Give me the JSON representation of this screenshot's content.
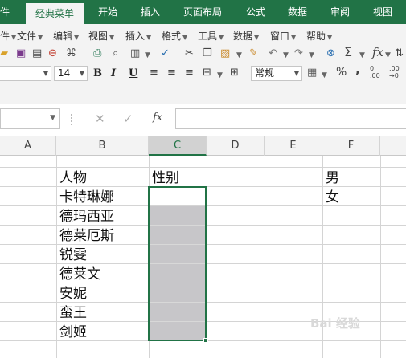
{
  "ribbon": {
    "tabs": [
      {
        "label": "件",
        "active": false
      },
      {
        "label": "经典菜单",
        "active": true
      },
      {
        "label": "开始",
        "active": false
      },
      {
        "label": "插入",
        "active": false
      },
      {
        "label": "页面布局",
        "active": false
      },
      {
        "label": "公式",
        "active": false
      },
      {
        "label": "数据",
        "active": false
      },
      {
        "label": "审阅",
        "active": false
      },
      {
        "label": "视图",
        "active": false
      }
    ]
  },
  "menubar": {
    "items": [
      {
        "label": "件"
      },
      {
        "label": "文件"
      },
      {
        "label": "编辑"
      },
      {
        "label": "视图"
      },
      {
        "label": "插入"
      },
      {
        "label": "格式"
      },
      {
        "label": "工具"
      },
      {
        "label": "数据"
      },
      {
        "label": "窗口"
      },
      {
        "label": "帮助"
      }
    ]
  },
  "toolbar": {
    "font_size": "14",
    "bold": "B",
    "italic": "I",
    "underline": "U",
    "number_format": "常规",
    "sigma": "Σ",
    "fx": "fx",
    "percent": "%",
    "comma": ",",
    "inc_decimal_a": "0",
    "inc_decimal_b": ".00",
    "dec_decimal_a": ".00",
    "dec_decimal_b": "→0"
  },
  "formula_bar": {
    "name_box": "",
    "fx_label": "fx",
    "formula": ""
  },
  "columns": [
    "A",
    "B",
    "C",
    "D",
    "E",
    "F"
  ],
  "selected_column": "C",
  "cells": {
    "B2": "人物",
    "C2": "性别",
    "F2": "男",
    "F3": "女",
    "B_list": [
      "卡特琳娜",
      "德玛西亚",
      "德莱厄斯",
      "锐雯",
      "德莱文",
      "安妮",
      "蛮王",
      "剑姬"
    ]
  },
  "colors": {
    "accent": "#217346",
    "selection_fill": "#c7c6c9",
    "header_selected": "#d2d2d2"
  },
  "watermark": "Bai 经验"
}
